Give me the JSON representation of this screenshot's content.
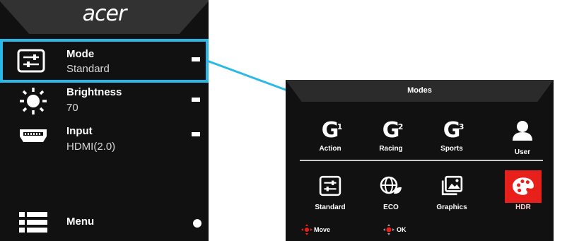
{
  "osd": {
    "logo": "acer",
    "items": [
      {
        "label": "Mode",
        "value": "Standard",
        "icon": "sliders-icon"
      },
      {
        "label": "Brightness",
        "value": "70",
        "icon": "sun-icon"
      },
      {
        "label": "Input",
        "value": "HDMI(2.0)",
        "icon": "hdmi-port-icon"
      }
    ],
    "menu": {
      "label": "Menu",
      "icon": "list-icon"
    }
  },
  "modes": {
    "title": "Modes",
    "row1": [
      {
        "label": "Action",
        "glyph": "G",
        "sup": "1"
      },
      {
        "label": "Racing",
        "glyph": "G",
        "sup": "2"
      },
      {
        "label": "Sports",
        "glyph": "G",
        "sup": "3"
      },
      {
        "label": "User",
        "icon": "user-icon"
      }
    ],
    "row2": [
      {
        "label": "Standard",
        "icon": "sliders-icon"
      },
      {
        "label": "ECO",
        "icon": "eco-globe-icon"
      },
      {
        "label": "Graphics",
        "icon": "pictures-icon"
      },
      {
        "label": "HDR",
        "icon": "palette-icon"
      }
    ],
    "footer": {
      "move": "Move",
      "ok": "OK"
    }
  },
  "colors": {
    "highlight": "#2ab9e6",
    "hdr_active": "#e8201b",
    "panel": "#111111"
  }
}
